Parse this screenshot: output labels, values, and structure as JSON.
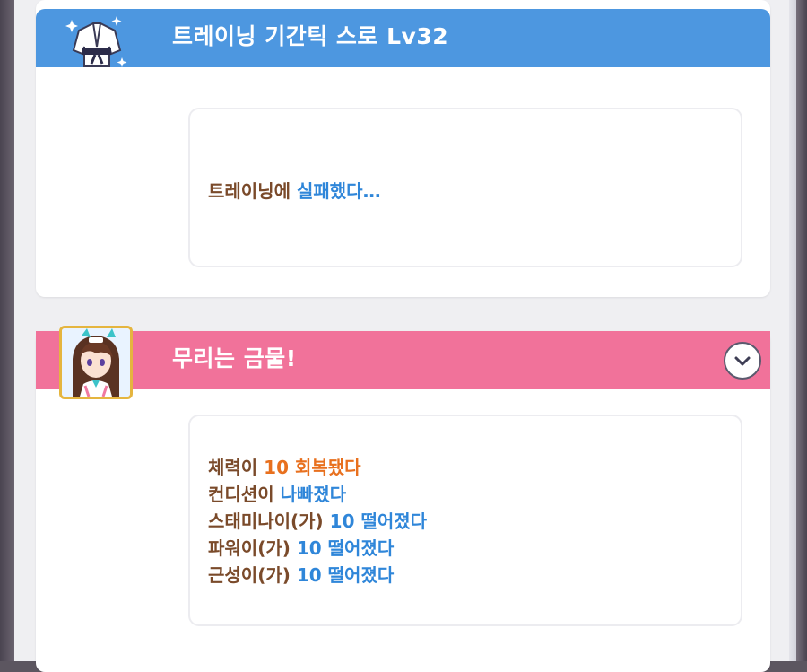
{
  "cards": [
    {
      "header_title": "트레이닝 기간틱 스로 Lv32",
      "header_color": "#4d97e0",
      "icon": "training-uniform-icon",
      "message": [
        {
          "parts": [
            {
              "text": "트레이닝에 ",
              "color": "brown"
            },
            {
              "text": "실패했다…",
              "color": "blue"
            }
          ]
        }
      ]
    },
    {
      "header_title": "무리는 금물!",
      "header_color": "#f1729a",
      "icon": "character-portrait",
      "toggle_icon": "chevron-down-icon",
      "message": [
        {
          "parts": [
            {
              "text": "체력이 ",
              "color": "brown"
            },
            {
              "text": "10 회복됐다",
              "color": "orange"
            }
          ]
        },
        {
          "parts": [
            {
              "text": "컨디션이 ",
              "color": "brown"
            },
            {
              "text": "나빠졌다",
              "color": "blue"
            }
          ]
        },
        {
          "parts": [
            {
              "text": "스태미나이(가) ",
              "color": "brown"
            },
            {
              "text": "10 떨어졌다",
              "color": "blue"
            }
          ]
        },
        {
          "parts": [
            {
              "text": "파워이(가) ",
              "color": "brown"
            },
            {
              "text": "10 떨어졌다",
              "color": "blue"
            }
          ]
        },
        {
          "parts": [
            {
              "text": "근성이(가) ",
              "color": "brown"
            },
            {
              "text": "10 떨어졌다",
              "color": "blue"
            }
          ]
        }
      ]
    }
  ],
  "colors": {
    "text_brown": "#7a4a2a",
    "text_blue": "#2f86d9",
    "text_orange": "#e8701e"
  }
}
